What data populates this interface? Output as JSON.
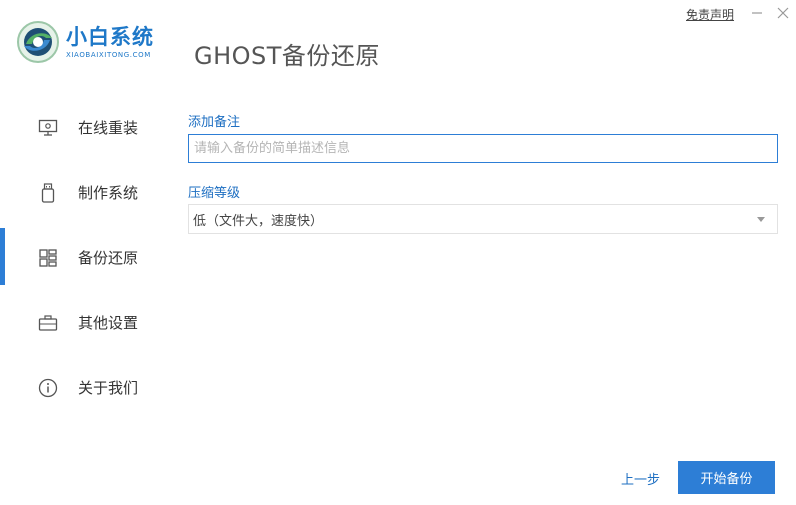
{
  "brand": {
    "name_cn": "小白系统",
    "name_en": "XIAOBAIXITONG.COM",
    "color": "#1e78c8"
  },
  "app_title": "GHOST备份还原",
  "window": {
    "disclaimer_label": "免责声明",
    "minimize_icon": "minimize-icon",
    "close_icon": "close-icon"
  },
  "sidebar": {
    "active_index": 2,
    "accent": "#2d7ed6",
    "items": [
      {
        "label": "在线重装",
        "icon": "monitor-icon"
      },
      {
        "label": "制作系统",
        "icon": "usb-drive-icon"
      },
      {
        "label": "备份还原",
        "icon": "grid-icon"
      },
      {
        "label": "其他设置",
        "icon": "briefcase-icon"
      },
      {
        "label": "关于我们",
        "icon": "info-icon"
      }
    ]
  },
  "form": {
    "note_label": "添加备注",
    "note_placeholder": "请输入备份的简单描述信息",
    "note_value": "",
    "compression_label": "压缩等级",
    "compression_value": "低（文件大，速度快）"
  },
  "footer": {
    "prev_label": "上一步",
    "start_label": "开始备份"
  }
}
